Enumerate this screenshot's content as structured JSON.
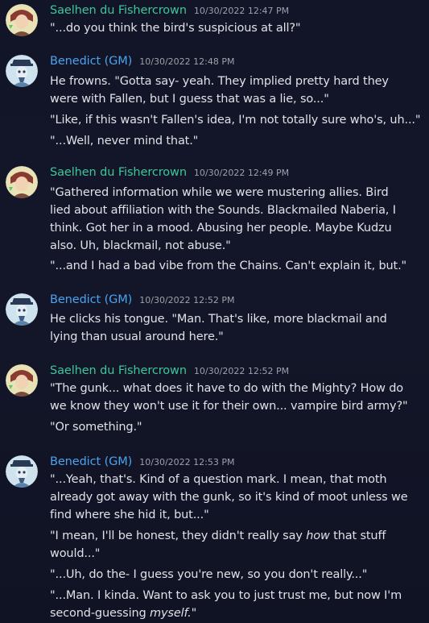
{
  "users": {
    "saelhen": {
      "name": "Saelhen du Fishercrown",
      "color": "#3fc69a"
    },
    "benedict": {
      "name": "Benedict (GM)",
      "color": "#4aa3ee"
    }
  },
  "groups": [
    {
      "timestamp": "10/30/2022 12:47 PM",
      "lines": [
        "\"...do you think the bird's suspicious at all?\""
      ]
    },
    {
      "timestamp": "10/30/2022 12:48 PM",
      "lines": [
        "He frowns. \"Gotta say- yeah. They implied pretty hard they",
        "were with Fallen, but I guess that was a lie, so...\"",
        "\"Like, if this wasn't Fallen's idea, I'm not totally sure who's, uh...\"",
        "\"...Well, never mind that.\""
      ]
    },
    {
      "timestamp": "10/30/2022 12:49 PM",
      "lines": [
        "\"Gathered information while we were mustering allies. Bird",
        "lied about affiliation with the Sounds. Blackmailed Naberia, I",
        "think. Got her in a mood. Abusing her people. Maybe Kudzu",
        "also. Uh, blackmail, not abuse.\"",
        "\"...and I had a bad vibe from the Chains. Can't explain it, but.\""
      ]
    },
    {
      "timestamp": "10/30/2022 12:52 PM",
      "lines": [
        "He clicks his tongue. \"Man. That's like, more blackmail and",
        "lying than usual around here.\""
      ]
    },
    {
      "timestamp": "10/30/2022 12:52 PM",
      "lines": [
        "\"The gunk... what does it have to do with the Mighty? How do",
        "we know they won't use it for their own... vampire bird army?\"",
        "\"Or something.\""
      ]
    },
    {
      "timestamp": "10/30/2022 12:53 PM",
      "lines": [
        "\"...Yeah, that's. Kind of a question mark. I mean, that moth",
        "already got away with the gunk, so it's kind of moot unless we",
        "find where she hid it, but...\"",
        "\"I mean, I'll be honest, they didn't really say ",
        "how",
        " that stuff",
        "would...\"",
        "\"...Uh, do the- I guess you're new, so you don't really...\"",
        "\"...Man. I kinda. Want to ask you to just trust me, but now I'm",
        "second-guessing ",
        "myself.",
        "\""
      ]
    }
  ]
}
